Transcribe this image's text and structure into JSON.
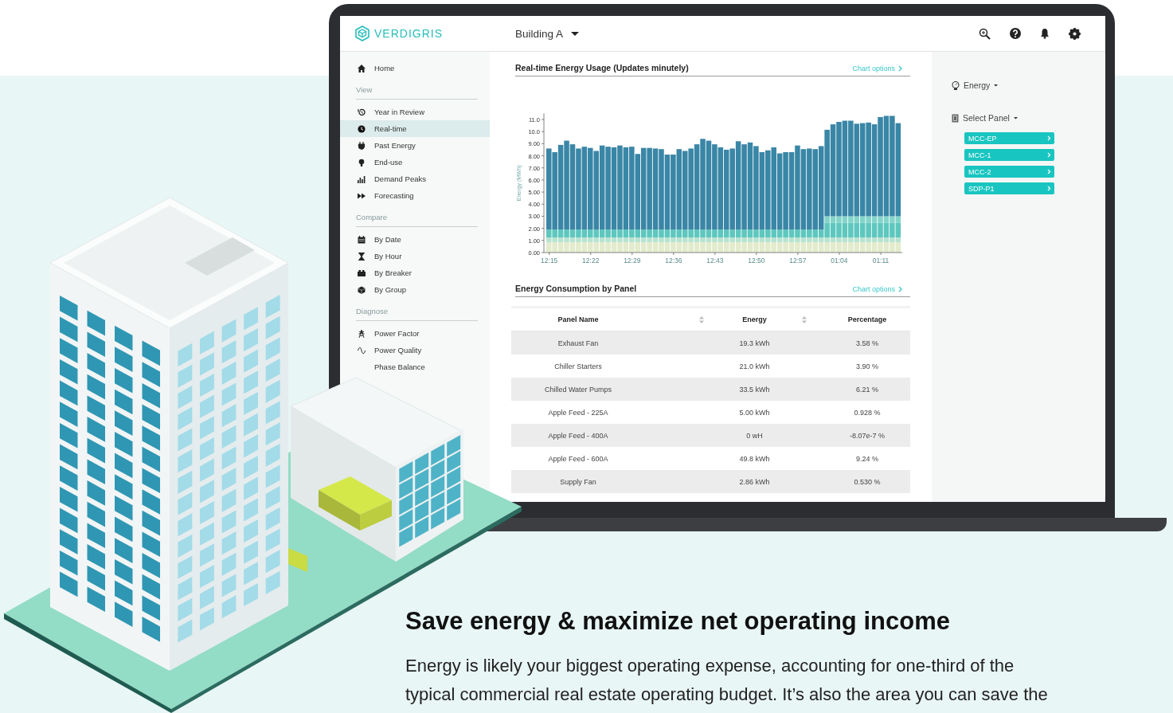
{
  "header": {
    "logo": "VERDIGRIS",
    "building": "Building A"
  },
  "sidebar": {
    "home": {
      "label": "Home",
      "selected": false
    },
    "sections": [
      {
        "title": "View",
        "items": [
          {
            "label": "Year in Review",
            "selected": false
          },
          {
            "label": "Real-time",
            "selected": true
          },
          {
            "label": "Past Energy",
            "selected": false
          },
          {
            "label": "End-use",
            "selected": false
          },
          {
            "label": "Demand Peaks",
            "selected": false
          },
          {
            "label": "Forecasting",
            "selected": false
          }
        ]
      },
      {
        "title": "Compare",
        "items": [
          {
            "label": "By Date",
            "selected": false
          },
          {
            "label": "By Hour",
            "selected": false
          },
          {
            "label": "By Breaker",
            "selected": false
          },
          {
            "label": "By Group",
            "selected": false
          }
        ]
      },
      {
        "title": "Diagnose",
        "items": [
          {
            "label": "Power Factor",
            "selected": false
          },
          {
            "label": "Power Quality",
            "selected": false
          },
          {
            "label": "Phase Balance",
            "selected": false
          }
        ]
      }
    ]
  },
  "usage_panel": {
    "title": "Real-time Energy Usage (Updates minutely)",
    "options": "Chart options",
    "chart_data": {
      "type": "bar",
      "stacked": true,
      "ylabel": "Energy (MWh)",
      "categories": [
        "12:15",
        null,
        null,
        null,
        null,
        null,
        null,
        "12:22",
        null,
        null,
        null,
        null,
        null,
        null,
        "12:29",
        null,
        null,
        null,
        null,
        null,
        null,
        "12:36",
        null,
        null,
        null,
        null,
        null,
        null,
        "12:43",
        null,
        null,
        null,
        null,
        null,
        null,
        "12:50",
        null,
        null,
        null,
        null,
        null,
        null,
        "12:57",
        null,
        null,
        null,
        null,
        null,
        null,
        "01:04",
        null,
        null,
        null,
        null,
        null,
        null,
        "01:11",
        null,
        null,
        null
      ],
      "ylim": [
        0,
        11.5
      ],
      "yticks": [
        {
          "value": 0,
          "label": "0.00"
        },
        {
          "value": 1,
          "label": "1.00"
        },
        {
          "value": 2,
          "label": "2.00"
        },
        {
          "value": 3,
          "label": "3.00"
        },
        {
          "value": 4,
          "label": "4.00"
        },
        {
          "value": 5,
          "label": "5.00"
        },
        {
          "value": 6,
          "label": "6.00"
        },
        {
          "value": 7,
          "label": "7.00"
        },
        {
          "value": 8,
          "label": "8.00"
        },
        {
          "value": 9,
          "label": "9.00"
        },
        {
          "value": 10,
          "label": "10.0"
        },
        {
          "value": 11,
          "label": "11.0"
        }
      ],
      "series": [
        {
          "color": "#e3ebcd",
          "values": [
            0.85,
            0.85,
            0.85,
            0.85,
            0.85,
            0.85,
            0.85,
            0.85,
            0.85,
            0.85,
            0.85,
            0.85,
            0.85,
            0.85,
            0.85,
            0.85,
            0.85,
            0.85,
            0.85,
            0.85,
            0.85,
            0.85,
            0.85,
            0.85,
            0.85,
            0.85,
            0.85,
            0.85,
            0.85,
            0.85,
            0.85,
            0.85,
            0.85,
            0.85,
            0.85,
            0.85,
            0.85,
            0.85,
            0.85,
            0.85,
            0.85,
            0.85,
            0.85,
            0.85,
            0.85,
            0.85,
            0.85,
            0.85,
            0.85,
            0.85,
            0.85,
            0.85,
            0.85,
            0.85,
            0.85,
            0.85,
            0.85,
            0.85,
            0.85,
            0.85
          ]
        },
        {
          "color": "#b8e3d1",
          "values": [
            0.4,
            0.4,
            0.4,
            0.4,
            0.4,
            0.4,
            0.4,
            0.4,
            0.4,
            0.4,
            0.4,
            0.4,
            0.4,
            0.4,
            0.4,
            0.4,
            0.4,
            0.4,
            0.4,
            0.4,
            0.4,
            0.4,
            0.4,
            0.4,
            0.4,
            0.4,
            0.4,
            0.4,
            0.4,
            0.4,
            0.4,
            0.4,
            0.4,
            0.4,
            0.4,
            0.4,
            0.4,
            0.4,
            0.4,
            0.4,
            0.4,
            0.4,
            0.4,
            0.4,
            0.4,
            0.4,
            0.4,
            0.4,
            0.4,
            0.4,
            0.4,
            0.4,
            0.4,
            0.4,
            0.4,
            0.4,
            0.4,
            0.4,
            0.4,
            0.4
          ]
        },
        {
          "color": "#5ec7be",
          "values": [
            0.65,
            0.65,
            0.65,
            0.65,
            0.65,
            0.65,
            0.65,
            0.65,
            0.65,
            0.65,
            0.65,
            0.65,
            0.65,
            0.65,
            0.65,
            0.65,
            0.65,
            0.65,
            0.65,
            0.65,
            0.65,
            0.65,
            0.65,
            0.65,
            0.65,
            0.65,
            0.65,
            0.65,
            0.65,
            0.65,
            0.65,
            0.65,
            0.65,
            0.65,
            0.65,
            0.65,
            0.65,
            0.65,
            0.65,
            0.65,
            0.65,
            0.65,
            0.65,
            0.65,
            0.65,
            0.65,
            0.65,
            1.2,
            1.2,
            1.2,
            1.2,
            1.2,
            1.2,
            1.2,
            1.2,
            1.2,
            1.2,
            1.2,
            1.2,
            1.2
          ]
        },
        {
          "color": "#83d4c9",
          "values": [
            0,
            0,
            0,
            0,
            0,
            0,
            0,
            0,
            0,
            0,
            0,
            0,
            0,
            0,
            0,
            0,
            0,
            0,
            0,
            0,
            0,
            0,
            0,
            0,
            0,
            0,
            0,
            0,
            0,
            0,
            0,
            0,
            0,
            0,
            0,
            0,
            0,
            0,
            0,
            0,
            0,
            0,
            0,
            0,
            0,
            0,
            0,
            0.55,
            0.55,
            0.55,
            0.55,
            0.55,
            0.55,
            0.55,
            0.55,
            0.55,
            0.55,
            0.55,
            0.55,
            0.55
          ]
        },
        {
          "color": "#3a86a6",
          "values": [
            6.7,
            6.4,
            7.0,
            7.35,
            7.05,
            6.7,
            6.85,
            6.75,
            6.5,
            6.95,
            6.85,
            6.8,
            6.95,
            6.8,
            6.85,
            6.25,
            6.75,
            6.75,
            6.7,
            6.65,
            6.2,
            6.2,
            6.65,
            6.5,
            6.7,
            7.05,
            7.5,
            7.35,
            7.05,
            6.8,
            6.6,
            6.7,
            7.3,
            7.05,
            7.2,
            6.9,
            6.4,
            6.55,
            6.8,
            6.3,
            6.4,
            6.4,
            6.95,
            6.65,
            6.7,
            6.65,
            6.9,
            7.15,
            7.6,
            7.8,
            7.9,
            7.9,
            7.65,
            7.7,
            7.75,
            7.6,
            8.2,
            8.3,
            8.3,
            7.7
          ]
        }
      ]
    }
  },
  "consumption_panel": {
    "title": "Energy Consumption by Panel",
    "options": "Chart options",
    "table": {
      "columns": [
        {
          "label": "Panel Name",
          "sortable": true
        },
        {
          "label": "Energy",
          "sortable": true
        },
        {
          "label": "Percentage",
          "sortable": false
        }
      ],
      "rows": [
        [
          "Exhaust Fan",
          "19.3 kWh",
          "3.58 %"
        ],
        [
          "Chiller Starters",
          "21.0 kWh",
          "3.90 %"
        ],
        [
          "Chilled Water Pumps",
          "33.5 kWh",
          "6.21 %"
        ],
        [
          "Apple Feed - 225A",
          "5.00 kWh",
          "0.928 %"
        ],
        [
          "Apple Feed - 400A",
          "0 wH",
          "-8.07e-7 %"
        ],
        [
          "Apple Feed - 600A",
          "49.8 kWh",
          "9.24 %"
        ],
        [
          "Supply Fan",
          "2.86 kWh",
          "0.530 %"
        ]
      ]
    }
  },
  "side_panel": {
    "energy_menu": "Energy",
    "panel_menu": "Select Panel",
    "panels": [
      "MCC-EP",
      "MCC-1",
      "MCC-2",
      "SDP-P1"
    ]
  },
  "headline": "Save energy & maximize net operating income",
  "body": "Energy is likely your biggest operating expense, accounting for one-third of the typical commercial real estate operating budget. It’s also the area you can save the"
}
